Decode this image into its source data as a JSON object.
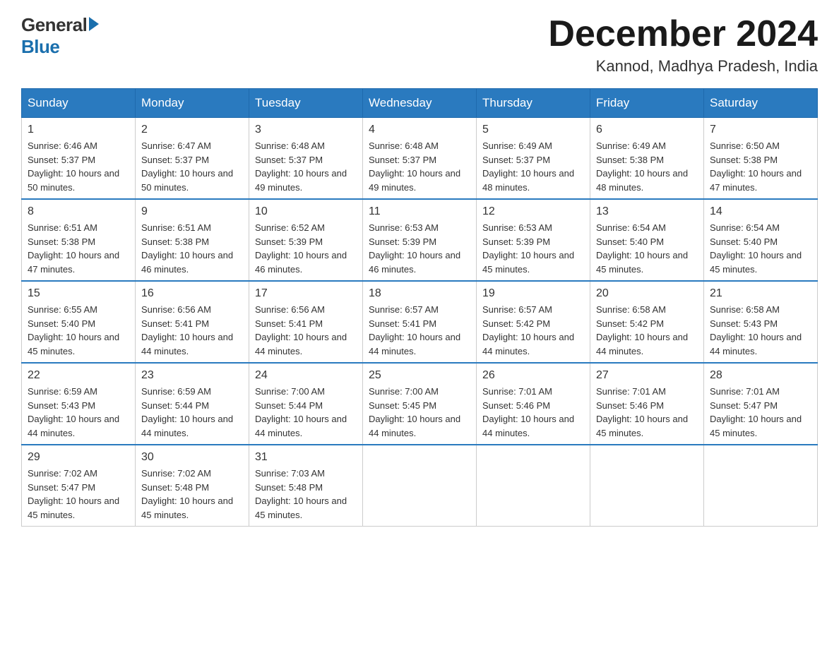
{
  "header": {
    "month_year": "December 2024",
    "location": "Kannod, Madhya Pradesh, India",
    "logo_general": "General",
    "logo_blue": "Blue"
  },
  "days_of_week": [
    "Sunday",
    "Monday",
    "Tuesday",
    "Wednesday",
    "Thursday",
    "Friday",
    "Saturday"
  ],
  "weeks": [
    [
      {
        "day": "1",
        "sunrise": "6:46 AM",
        "sunset": "5:37 PM",
        "daylight": "10 hours and 50 minutes."
      },
      {
        "day": "2",
        "sunrise": "6:47 AM",
        "sunset": "5:37 PM",
        "daylight": "10 hours and 50 minutes."
      },
      {
        "day": "3",
        "sunrise": "6:48 AM",
        "sunset": "5:37 PM",
        "daylight": "10 hours and 49 minutes."
      },
      {
        "day": "4",
        "sunrise": "6:48 AM",
        "sunset": "5:37 PM",
        "daylight": "10 hours and 49 minutes."
      },
      {
        "day": "5",
        "sunrise": "6:49 AM",
        "sunset": "5:37 PM",
        "daylight": "10 hours and 48 minutes."
      },
      {
        "day": "6",
        "sunrise": "6:49 AM",
        "sunset": "5:38 PM",
        "daylight": "10 hours and 48 minutes."
      },
      {
        "day": "7",
        "sunrise": "6:50 AM",
        "sunset": "5:38 PM",
        "daylight": "10 hours and 47 minutes."
      }
    ],
    [
      {
        "day": "8",
        "sunrise": "6:51 AM",
        "sunset": "5:38 PM",
        "daylight": "10 hours and 47 minutes."
      },
      {
        "day": "9",
        "sunrise": "6:51 AM",
        "sunset": "5:38 PM",
        "daylight": "10 hours and 46 minutes."
      },
      {
        "day": "10",
        "sunrise": "6:52 AM",
        "sunset": "5:39 PM",
        "daylight": "10 hours and 46 minutes."
      },
      {
        "day": "11",
        "sunrise": "6:53 AM",
        "sunset": "5:39 PM",
        "daylight": "10 hours and 46 minutes."
      },
      {
        "day": "12",
        "sunrise": "6:53 AM",
        "sunset": "5:39 PM",
        "daylight": "10 hours and 45 minutes."
      },
      {
        "day": "13",
        "sunrise": "6:54 AM",
        "sunset": "5:40 PM",
        "daylight": "10 hours and 45 minutes."
      },
      {
        "day": "14",
        "sunrise": "6:54 AM",
        "sunset": "5:40 PM",
        "daylight": "10 hours and 45 minutes."
      }
    ],
    [
      {
        "day": "15",
        "sunrise": "6:55 AM",
        "sunset": "5:40 PM",
        "daylight": "10 hours and 45 minutes."
      },
      {
        "day": "16",
        "sunrise": "6:56 AM",
        "sunset": "5:41 PM",
        "daylight": "10 hours and 44 minutes."
      },
      {
        "day": "17",
        "sunrise": "6:56 AM",
        "sunset": "5:41 PM",
        "daylight": "10 hours and 44 minutes."
      },
      {
        "day": "18",
        "sunrise": "6:57 AM",
        "sunset": "5:41 PM",
        "daylight": "10 hours and 44 minutes."
      },
      {
        "day": "19",
        "sunrise": "6:57 AM",
        "sunset": "5:42 PM",
        "daylight": "10 hours and 44 minutes."
      },
      {
        "day": "20",
        "sunrise": "6:58 AM",
        "sunset": "5:42 PM",
        "daylight": "10 hours and 44 minutes."
      },
      {
        "day": "21",
        "sunrise": "6:58 AM",
        "sunset": "5:43 PM",
        "daylight": "10 hours and 44 minutes."
      }
    ],
    [
      {
        "day": "22",
        "sunrise": "6:59 AM",
        "sunset": "5:43 PM",
        "daylight": "10 hours and 44 minutes."
      },
      {
        "day": "23",
        "sunrise": "6:59 AM",
        "sunset": "5:44 PM",
        "daylight": "10 hours and 44 minutes."
      },
      {
        "day": "24",
        "sunrise": "7:00 AM",
        "sunset": "5:44 PM",
        "daylight": "10 hours and 44 minutes."
      },
      {
        "day": "25",
        "sunrise": "7:00 AM",
        "sunset": "5:45 PM",
        "daylight": "10 hours and 44 minutes."
      },
      {
        "day": "26",
        "sunrise": "7:01 AM",
        "sunset": "5:46 PM",
        "daylight": "10 hours and 44 minutes."
      },
      {
        "day": "27",
        "sunrise": "7:01 AM",
        "sunset": "5:46 PM",
        "daylight": "10 hours and 45 minutes."
      },
      {
        "day": "28",
        "sunrise": "7:01 AM",
        "sunset": "5:47 PM",
        "daylight": "10 hours and 45 minutes."
      }
    ],
    [
      {
        "day": "29",
        "sunrise": "7:02 AM",
        "sunset": "5:47 PM",
        "daylight": "10 hours and 45 minutes."
      },
      {
        "day": "30",
        "sunrise": "7:02 AM",
        "sunset": "5:48 PM",
        "daylight": "10 hours and 45 minutes."
      },
      {
        "day": "31",
        "sunrise": "7:03 AM",
        "sunset": "5:48 PM",
        "daylight": "10 hours and 45 minutes."
      },
      null,
      null,
      null,
      null
    ]
  ]
}
